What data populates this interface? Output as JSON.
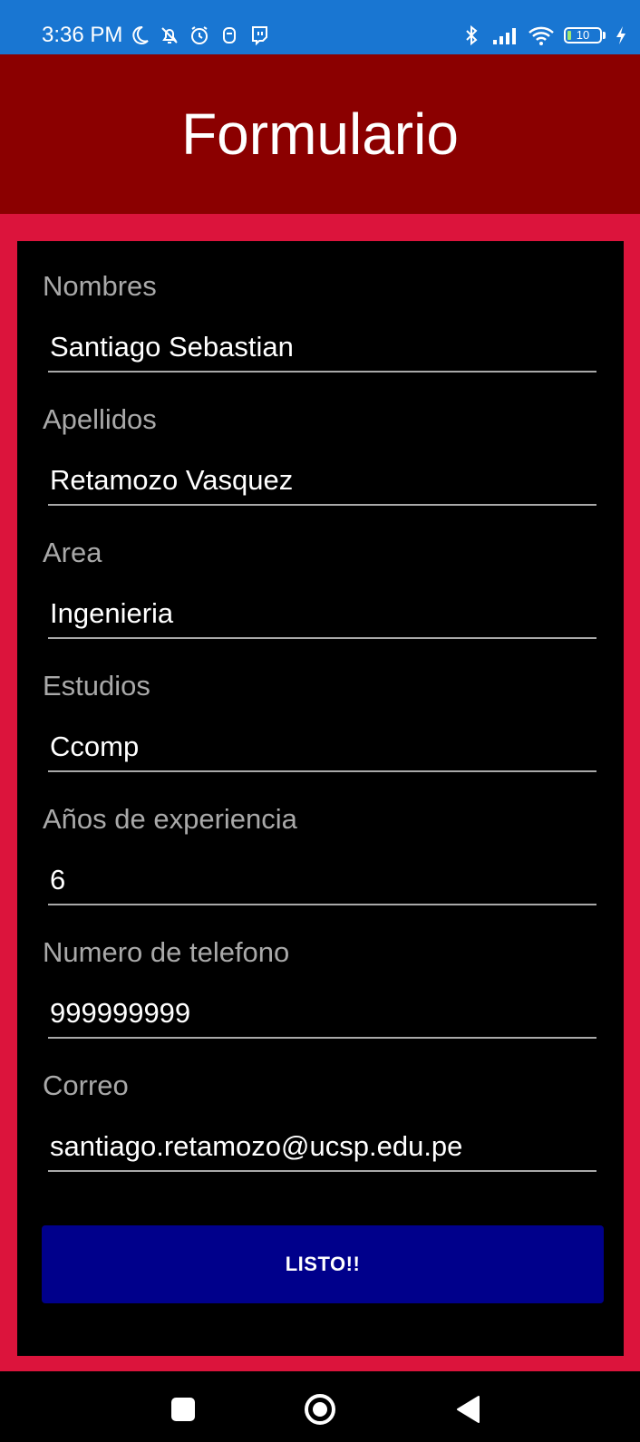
{
  "status_bar": {
    "time": "3:36 PM",
    "left_icons": [
      "moon-icon",
      "silent-bell-icon",
      "alarm-icon",
      "app-notification-icon",
      "twitch-icon"
    ],
    "right_icons": [
      "bluetooth-icon",
      "signal-icon",
      "wifi-icon"
    ],
    "battery_level": "10",
    "charging": true,
    "background_color": "#1976d2"
  },
  "app_bar": {
    "title": "Formulario",
    "background_color": "#8b0000"
  },
  "form": {
    "frame_color": "#dc143c",
    "fields": [
      {
        "label": "Nombres",
        "value": "Santiago Sebastian"
      },
      {
        "label": "Apellidos",
        "value": "Retamozo Vasquez"
      },
      {
        "label": "Area",
        "value": "Ingenieria"
      },
      {
        "label": "Estudios",
        "value": "Ccomp"
      },
      {
        "label": "Años de experiencia",
        "value": "6"
      },
      {
        "label": "Numero de telefono",
        "value": "999999999"
      },
      {
        "label": "Correo",
        "value": "santiago.retamozo@ucsp.edu.pe"
      }
    ],
    "submit_label": "LISTO!!",
    "submit_color": "#00008b"
  },
  "nav_bar": {
    "buttons": [
      "recents-square-icon",
      "home-circle-icon",
      "back-triangle-icon"
    ]
  }
}
